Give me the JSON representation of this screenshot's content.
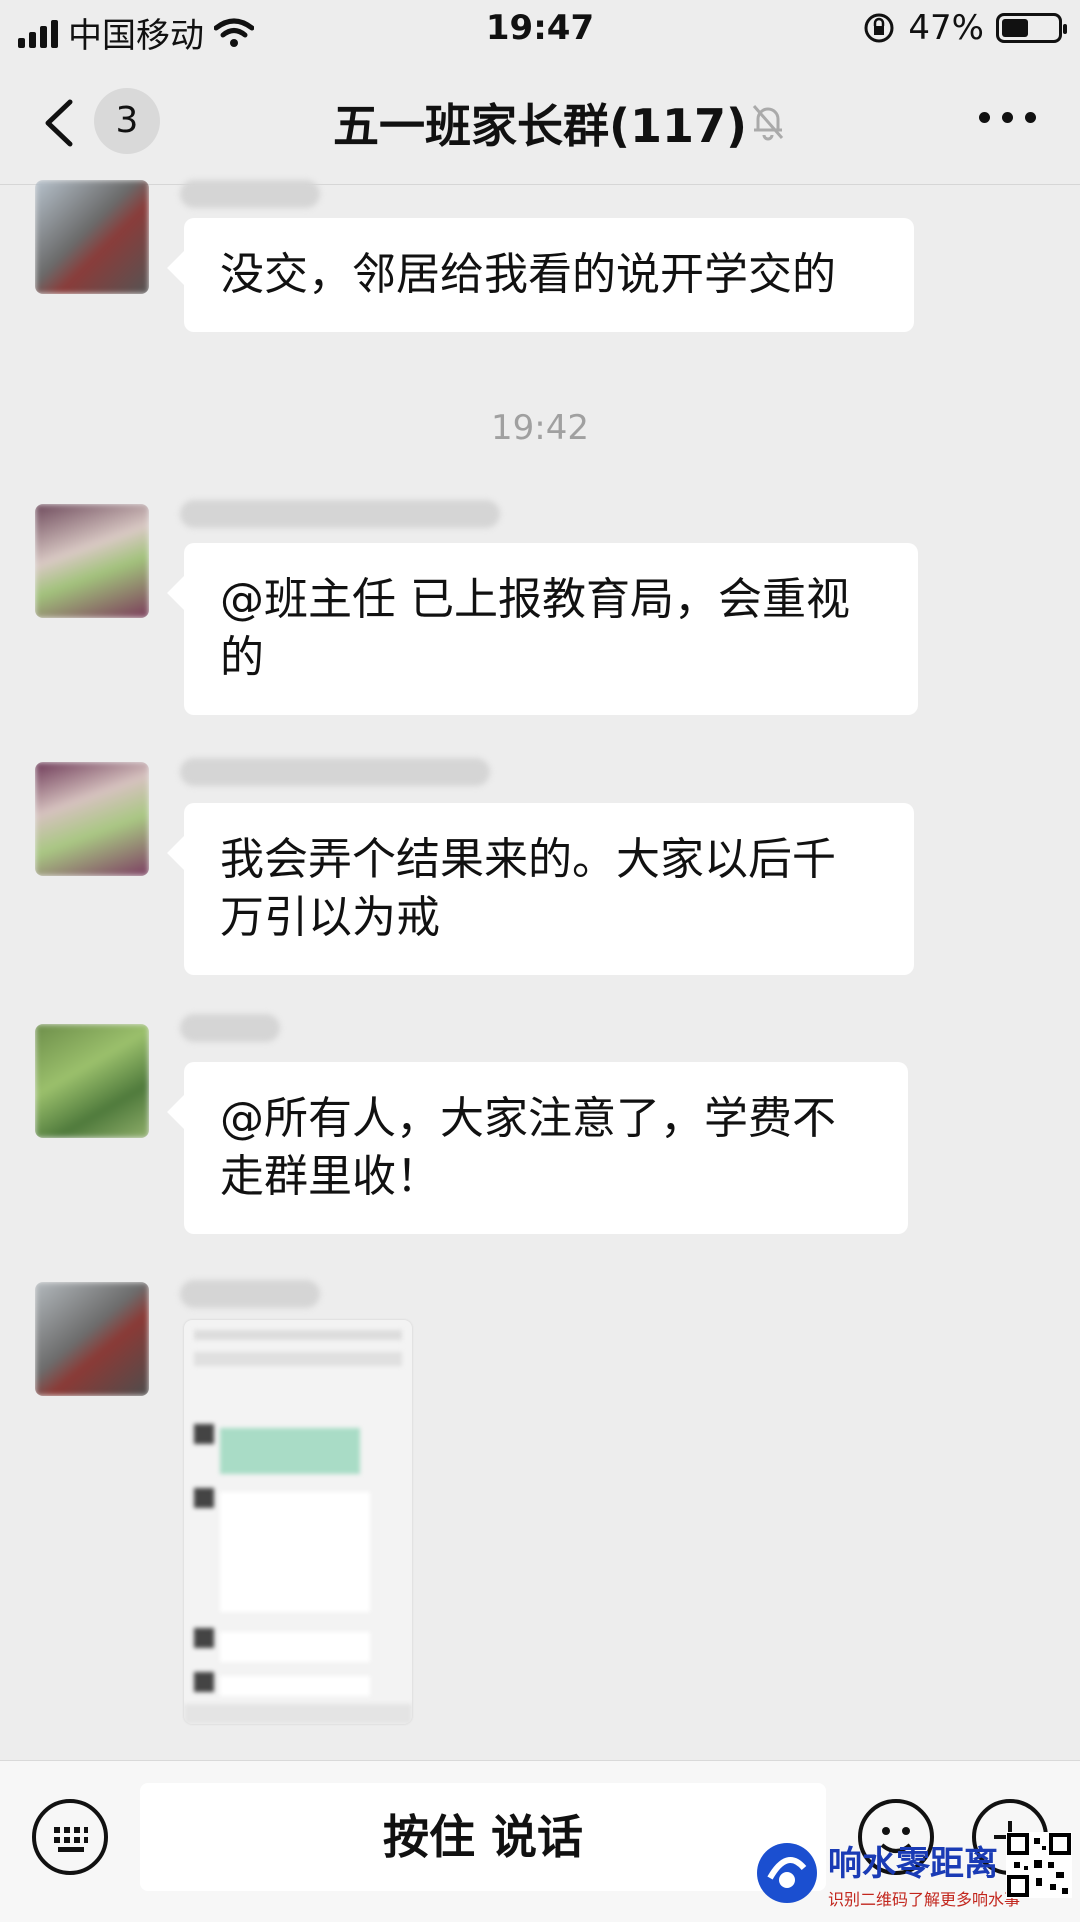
{
  "status_bar": {
    "carrier": "中国移动",
    "time": "19:47",
    "battery": "47%"
  },
  "nav": {
    "unread_count": "3",
    "title": "五一班家长群(117)"
  },
  "messages": [
    {
      "text": "没交，邻居给我看的说开学交的"
    },
    {
      "text": "@班主任 已上报教育局，会重视的"
    },
    {
      "text": "我会弄个结果来的。大家以后千万引以为戒"
    },
    {
      "text": "@所有人，大家注意了，学费不走群里收！"
    }
  ],
  "timestamp": "19:42",
  "input_bar": {
    "hold_to_talk": "按住 说话"
  },
  "watermark": {
    "brand": "响水零距离",
    "caption": "识别二维码了解更多响水事"
  },
  "colors": {
    "background": "#ededed",
    "bubble": "#ffffff",
    "watermark_blue": "#1a3bb5",
    "watermark_red": "#c2261d"
  }
}
